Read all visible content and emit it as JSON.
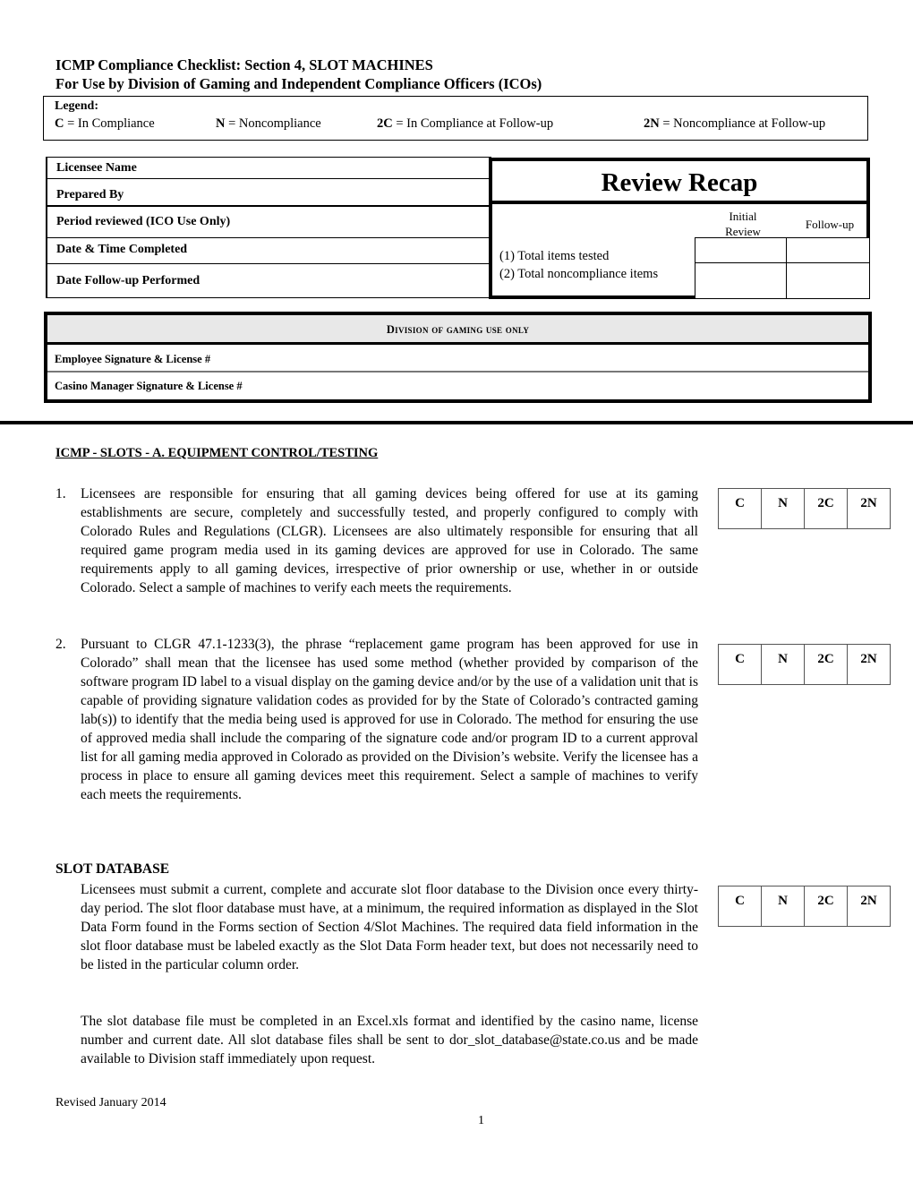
{
  "header": {
    "title": "ICMP Compliance Checklist: Section 4, SLOT MACHINES",
    "subtitle": "For Use by Division of Gaming and Independent Compliance Officers (ICOs)"
  },
  "legend": {
    "title": "Legend:",
    "items": [
      {
        "code": "C",
        "text": " = In Compliance"
      },
      {
        "code": "N",
        "text": " = Noncompliance"
      },
      {
        "code": "2C",
        "text": " = In Compliance at Follow-up"
      },
      {
        "code": "2N",
        "text": " = Noncompliance at Follow-up"
      }
    ]
  },
  "info_fields": [
    {
      "label": "Licensee Name",
      "value": ""
    },
    {
      "label": "Prepared By",
      "value": ""
    },
    {
      "label": "Period reviewed (ICO Use Only)",
      "value": ""
    },
    {
      "label": "Date & Time Completed",
      "value": ""
    },
    {
      "label": "Date Follow-up Performed",
      "value": ""
    }
  ],
  "review_recap": {
    "title": "Review Recap",
    "col_initial": "Initial Review",
    "col_initial_l1": "Initial",
    "col_initial_l2": "Review",
    "col_followup": "Follow-up",
    "rows": [
      {
        "label": "(1) Total items tested",
        "initial": "",
        "followup": ""
      },
      {
        "label": "(2)  Total noncompliance items",
        "initial": "",
        "followup": ""
      }
    ]
  },
  "division": {
    "heading": "Division of gaming use only",
    "rows": [
      {
        "label": "Employee Signature & License #",
        "value": ""
      },
      {
        "label": "Casino Manager Signature & License #",
        "value": ""
      }
    ]
  },
  "section": {
    "heading": "ICMP - SLOTS - A. EQUIPMENT CONTROL/TESTING",
    "compliance_options": [
      "C",
      "N",
      "2C",
      "2N"
    ],
    "items": [
      {
        "number": "1.",
        "text": "Licensees are responsible for ensuring that all gaming devices being offered for use at its gaming establishments are secure, completely and successfully tested, and properly configured to comply with Colorado Rules and Regulations (CLGR).  Licensees are also ultimately responsible for ensuring that all required game program media used in its gaming devices are approved for use in Colorado.  The same requirements apply to all gaming devices, irrespective of prior ownership or use, whether in or outside Colorado.  Select a sample of machines to verify each meets the requirements."
      },
      {
        "number": "2.",
        "text": "Pursuant to CLGR 47.1-1233(3), the phrase “replacement game program has been approved for use in Colorado” shall mean that the licensee has used some method (whether provided by comparison of the software program ID label to a visual display on the gaming device and/or by the use of a validation unit that is capable of providing signature validation codes as provided for by the State of Colorado’s contracted gaming lab(s)) to identify that the media being used is approved for use in Colorado.  The method for ensuring the use of approved media shall include the comparing of the signature code and/or program ID to a current approval list for all gaming media approved in Colorado as provided on the Division’s website.  Verify the licensee has a process in place to ensure all gaming devices meet this requirement.  Select a sample of machines to verify each meets the requirements."
      }
    ],
    "slot_database": {
      "heading": "SLOT DATABASE",
      "paragraph1": "Licensees must submit a current, complete and accurate slot floor database to the Division once every thirty-day period.  The slot floor database must have, at a minimum, the required information as displayed in the Slot Data Form found in the Forms section of Section 4/Slot Machines.  The required data field information in the slot floor database must be labeled exactly as the Slot Data Form header text, but does not necessarily need to be listed in the particular column order.",
      "paragraph2": "The slot database file must be completed in an Excel.xls format and identified by the casino name, license number and current date.  All slot database files shall be sent to dor_slot_database@state.co.us and be made available to Division staff immediately upon request."
    }
  },
  "footer": {
    "revised": "Revised January 2014",
    "page_number": "1"
  }
}
